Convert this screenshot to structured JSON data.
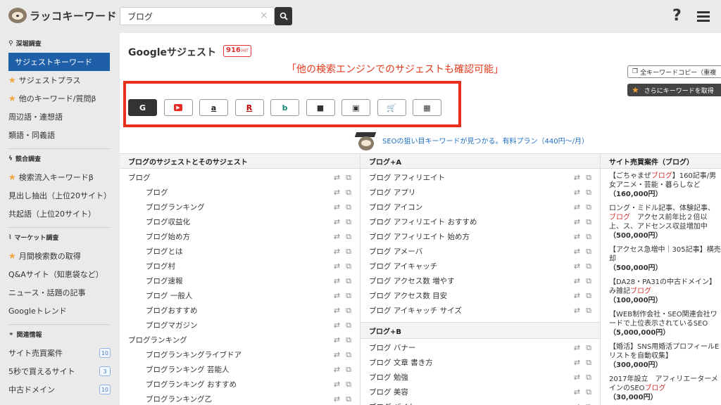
{
  "header": {
    "logo_text": "ラッコキーワード",
    "search_value": "ブログ",
    "clear_symbol": "×",
    "help_symbol": "?"
  },
  "sidebar": {
    "sections": [
      {
        "title": "深堀調査",
        "icon": "search-icon",
        "items": [
          {
            "label": "サジェストキーワード",
            "active": true,
            "star": false
          },
          {
            "label": "サジェストプラス",
            "star": true
          },
          {
            "label": "他のキーワード/質問β",
            "star": true
          },
          {
            "label": "周辺語・連想語",
            "star": false
          },
          {
            "label": "類語・同義語",
            "star": false
          }
        ]
      },
      {
        "title": "競合調査",
        "icon": "bolt-icon",
        "items": [
          {
            "label": "検索流入キーワードβ",
            "star": true
          },
          {
            "label": "見出し抽出（上位20サイト）",
            "star": false
          },
          {
            "label": "共起語（上位20サイト）",
            "star": false
          }
        ]
      },
      {
        "title": "マーケット調査",
        "icon": "chart-icon",
        "items": [
          {
            "label": "月間検索数の取得",
            "star": true
          },
          {
            "label": "Q&Aサイト（知恵袋など）",
            "star": false
          },
          {
            "label": "ニュース・話題の記事",
            "star": false
          },
          {
            "label": "Googleトレンド",
            "star": false
          }
        ]
      },
      {
        "title": "関連情報",
        "icon": "link-icon",
        "items": [
          {
            "label": "サイト売買案件",
            "star": false,
            "badge": "10"
          },
          {
            "label": "5秒で買えるサイト",
            "star": false,
            "badge": "3"
          },
          {
            "label": "中古ドメイン",
            "star": false,
            "badge": "10"
          }
        ]
      }
    ]
  },
  "main": {
    "title": "Googleサジェスト",
    "hit_count": "916",
    "hit_label": "HIT",
    "annotation": "「他の検索エンジンでのサジェストも確認可能」",
    "copy_button": "全キーワードコピー（重複",
    "more_button": "さらにキーワードを取得",
    "engines": [
      {
        "name": "google",
        "icon": "G",
        "active": true,
        "color": "#ffffff"
      },
      {
        "name": "youtube",
        "icon": "▶",
        "active": false,
        "color": "#e52d27"
      },
      {
        "name": "amazon",
        "icon": "a",
        "active": false,
        "color": "#222222"
      },
      {
        "name": "rakuten",
        "icon": "R",
        "active": false,
        "color": "#bf0000"
      },
      {
        "name": "bing",
        "icon": "b",
        "active": false,
        "color": "#138a75"
      },
      {
        "name": "video",
        "icon": "■",
        "active": false,
        "color": "#333333"
      },
      {
        "name": "image",
        "icon": "▣",
        "active": false,
        "color": "#333333"
      },
      {
        "name": "shopping",
        "icon": "🛒",
        "active": false,
        "color": "#333333"
      },
      {
        "name": "app",
        "icon": "▦",
        "active": false,
        "color": "#333333"
      }
    ],
    "promo_text": "SEOの狙い目キーワードが見つかる。有料プラン（440円〜/月）",
    "columns": {
      "col1": {
        "header": "ブログのサジェストとそのサジェスト",
        "rows": [
          {
            "text": "ブログ",
            "indent": 0
          },
          {
            "text": "ブログ",
            "indent": 1
          },
          {
            "text": "ブログランキング",
            "indent": 1
          },
          {
            "text": "ブログ収益化",
            "indent": 1
          },
          {
            "text": "ブログ始め方",
            "indent": 1
          },
          {
            "text": "ブログとは",
            "indent": 1
          },
          {
            "text": "ブログ村",
            "indent": 1
          },
          {
            "text": "ブログ速報",
            "indent": 1
          },
          {
            "text": "ブログ 一般人",
            "indent": 1
          },
          {
            "text": "ブログおすすめ",
            "indent": 1
          },
          {
            "text": "ブログマガジン",
            "indent": 1
          },
          {
            "text": "ブログランキング",
            "indent": 0
          },
          {
            "text": "ブログランキングライブドア",
            "indent": 1
          },
          {
            "text": "ブログランキング 芸能人",
            "indent": 1
          },
          {
            "text": "ブログランキング おすすめ",
            "indent": 1
          },
          {
            "text": "ブログランキング乙",
            "indent": 1
          }
        ]
      },
      "col2": {
        "header": "ブログ+A",
        "rows": [
          "ブログ アフィリエイト",
          "ブログ アプリ",
          "ブログ アイコン",
          "ブログ アフィリエイト おすすめ",
          "ブログ アフィリエイト 始め方",
          "ブログ アメーバ",
          "ブログ アイキャッチ",
          "ブログ アクセス数 増やす",
          "ブログ アクセス数 目安",
          "ブログ アイキャッチ サイズ"
        ],
        "sub_header": "ブログ+B",
        "sub_rows": [
          "ブログ バナー",
          "ブログ 文章 書き方",
          "ブログ 勉強",
          "ブログ 美容",
          "ブログ バイト"
        ]
      },
      "col3": {
        "header": "サイト売買案件（ブログ）",
        "items": [
          {
            "pre": "【ごちゃまぜ",
            "hl": "ブログ",
            "post": "】160記事/男女アニメ・芸能・暮らしなど",
            "price": "（160,000円）"
          },
          {
            "pre": "ロング・ミドル記事、体験記事、",
            "hl": "ブログ",
            "post": "　アクセス前年比２倍以上、ス、アドセンス収益増加中",
            "price": "（500,000円）"
          },
          {
            "pre": "【アクセス急増中｜305記事】横売却",
            "hl": "",
            "post": "",
            "price": "（500,000円）"
          },
          {
            "pre": "【DA28・PA31の中古ドメイン】み雑記",
            "hl": "ブログ",
            "post": "",
            "price": "（100,000円）"
          },
          {
            "pre": "【WEB制作会社・SEO関連会社ワードで上位表示されているSEO",
            "hl": "",
            "post": "",
            "price": "（5,000,000円）"
          },
          {
            "pre": "【婚活】SNS用婚活プロフィールEリストを自動収集】",
            "hl": "",
            "post": "",
            "price": "（300,000円）"
          },
          {
            "pre": "2017年設立　アフィリエーターメインのSEO",
            "hl": "ブログ",
            "post": "",
            "price": "（30,000円）"
          }
        ]
      }
    }
  }
}
